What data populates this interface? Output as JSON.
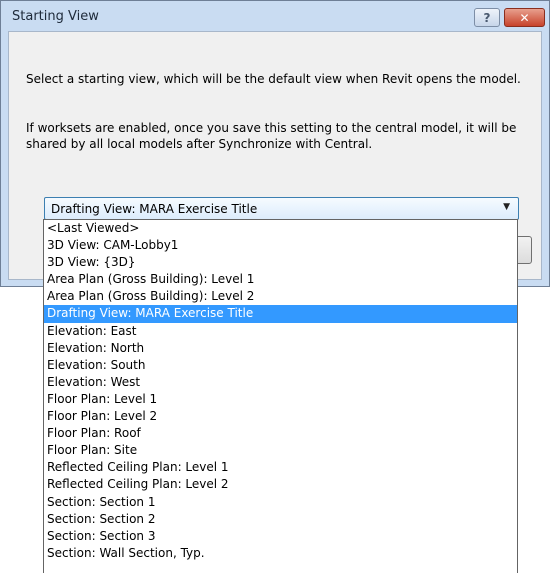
{
  "dialog": {
    "title": "Starting View",
    "help_label": "?",
    "close_label": "✕",
    "paragraph1": "Select a starting view, which will be the default view when Revit opens the model.",
    "paragraph2": "If worksets are enabled, once you save this setting to the central model, it will be shared by all local models after Synchronize with Central."
  },
  "view_select": {
    "selected": "Drafting View: MARA Exercise Title",
    "arrow": "▼",
    "options": [
      "<Last Viewed>",
      "3D View: CAM-Lobby1",
      "3D View: {3D}",
      "Area Plan (Gross Building): Level 1",
      "Area Plan (Gross Building): Level 2",
      "Drafting View: MARA Exercise Title",
      "Elevation: East",
      "Elevation: North",
      "Elevation: South",
      "Elevation: West",
      "Floor Plan: Level 1",
      "Floor Plan: Level 2",
      "Floor Plan: Roof",
      "Floor Plan: Site",
      "Reflected Ceiling Plan: Level 1",
      "Reflected Ceiling Plan: Level 2",
      "Section: Section 1",
      "Section: Section 2",
      "Section: Section 3",
      "Section: Wall Section, Typ."
    ],
    "highlighted_index": 5
  }
}
